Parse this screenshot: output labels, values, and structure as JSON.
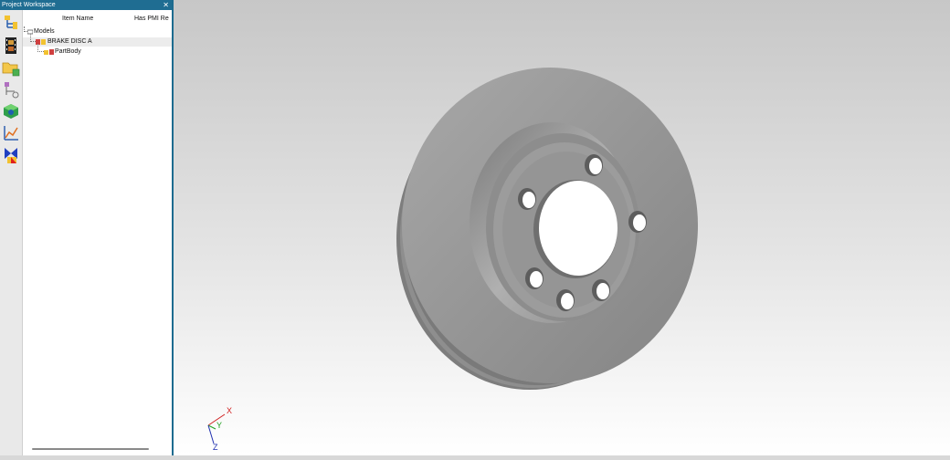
{
  "panel": {
    "title": "Project Workspace",
    "close_glyph": "✕",
    "columns": [
      "Item Name",
      "Has PMI Re"
    ],
    "tree": [
      {
        "label": "Models",
        "icon": "models-folder-icon"
      },
      {
        "label": "BRAKE DISC A",
        "icon": "assembly-icon"
      },
      {
        "label": "PartBody",
        "icon": "part-body-icon"
      }
    ]
  },
  "toolbar": {
    "icons": [
      "workspace-tree-icon",
      "film-strip-icon",
      "folder-add-icon",
      "hierarchy-icon",
      "component-cube-icon",
      "coordinate-graph-icon",
      "flag-pmi-icon"
    ]
  },
  "viewport": {
    "triad": {
      "x": "X",
      "y": "Y",
      "z": "Z"
    },
    "colors": {
      "background_top": "#c7c7c7",
      "background_bottom": "#ffffff",
      "model": "#909090"
    }
  }
}
